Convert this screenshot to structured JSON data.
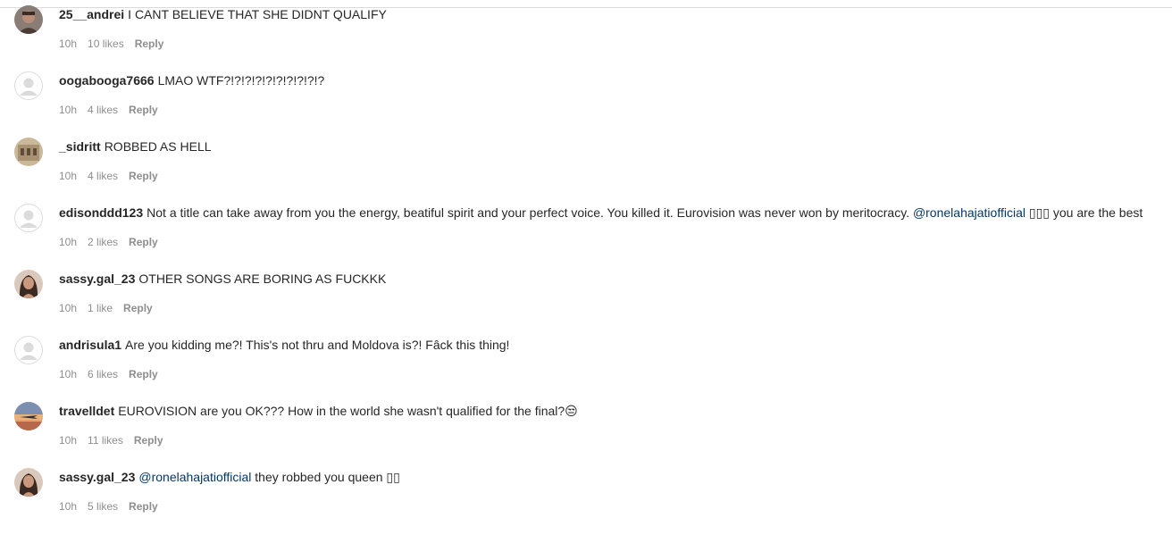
{
  "comments": [
    {
      "username": "25__andrei",
      "avatar": "photo-man-portrait",
      "text": "I CANT BELIEVE THAT SHE DIDNT QUALIFY",
      "time": "10h",
      "likes": "10 likes",
      "reply": "Reply"
    },
    {
      "username": "oogabooga7666",
      "avatar": "default-user-icon",
      "text": "LMAO WTF?!?!?!?!?!?!?!?!?!?",
      "time": "10h",
      "likes": "4 likes",
      "reply": "Reply"
    },
    {
      "username": "_sidritt",
      "avatar": "photo-building-beige",
      "text": "ROBBED AS HELL",
      "time": "10h",
      "likes": "4 likes",
      "reply": "Reply"
    },
    {
      "username": "edisonddd123",
      "avatar": "default-user-icon",
      "text_before": "Not a title can take away from you the energy, beatiful spirit and your perfect voice. You killed it. Eurovision was never won by meritocracy.",
      "mention": "@ronelahajatiofficial",
      "text_after": "▯▯▯ you are the best",
      "time": "10h",
      "likes": "2 likes",
      "reply": "Reply"
    },
    {
      "username": "sassy.gal_23",
      "avatar": "photo-woman-dark-hair",
      "text": "OTHER SONGS ARE BORING AS FUCKKK",
      "time": "10h",
      "likes": "1 like",
      "reply": "Reply"
    },
    {
      "username": "andrisula1",
      "avatar": "default-user-icon",
      "text": "Are you kidding me?! This's not thru and Moldova is?! Fâck this thing!",
      "time": "10h",
      "likes": "6 likes",
      "reply": "Reply"
    },
    {
      "username": "travelldet",
      "avatar": "photo-airplane-sunset",
      "text": "EUROVISION are you OK??? How in the world she wasn't qualified for the final?😒",
      "time": "10h",
      "likes": "11 likes",
      "reply": "Reply"
    },
    {
      "username": "sassy.gal_23",
      "avatar": "photo-woman-dark-hair",
      "mention": "@ronelahajatiofficial",
      "text_after": "they robbed you queen ▯▯",
      "time": "10h",
      "likes": "5 likes",
      "reply": "Reply"
    }
  ],
  "colors": {
    "text": "#262626",
    "meta": "#8e8e8e",
    "mention": "#00376b",
    "divider": "#dbdbdb"
  }
}
